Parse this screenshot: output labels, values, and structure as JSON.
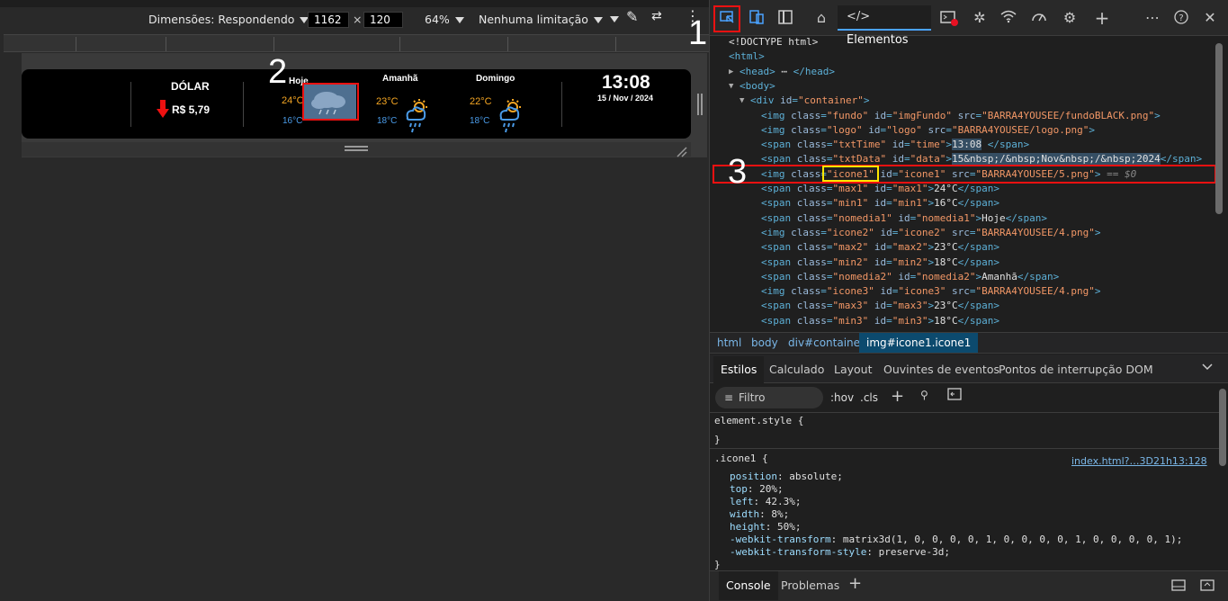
{
  "device_toolbar": {
    "dimensions_label": "Dimensões: Respondendo",
    "width_value": "1162",
    "times": "×",
    "height_value": "120",
    "zoom": "64%",
    "throttle": "Nenhuma limitação"
  },
  "widget": {
    "dollar_title": "DÓLAR",
    "dollar_value": "R$ 5,79",
    "days": [
      {
        "name": "Hoje",
        "max": "24°C",
        "min": "16°C"
      },
      {
        "name": "Amanhã",
        "max": "23°C",
        "min": "18°C"
      },
      {
        "name": "Domingo",
        "max": "22°C",
        "min": "18°C"
      }
    ],
    "time": "13:08",
    "date": "15 / Nov / 2024"
  },
  "annotations": {
    "n1": "1",
    "n2": "2",
    "n3": "3"
  },
  "devtools": {
    "tab_elements": "Elementos",
    "dom_lines": [
      {
        "indent": 0,
        "parts": [
          [
            "txt",
            "<!DOCTYPE html>"
          ]
        ]
      },
      {
        "indent": 0,
        "parts": [
          [
            "tag",
            "<html>"
          ]
        ]
      },
      {
        "indent": 1,
        "arrow": "▶",
        "parts": [
          [
            "tag",
            "<head>"
          ],
          [
            "txt",
            " ⋯ "
          ],
          [
            "tag",
            "</head>"
          ]
        ]
      },
      {
        "indent": 1,
        "arrow": "▼",
        "parts": [
          [
            "tag",
            "<body>"
          ]
        ]
      },
      {
        "indent": 2,
        "arrow": "▼",
        "parts": [
          [
            "tag",
            "<div "
          ],
          [
            "attr",
            "id"
          ],
          [
            "tag",
            "="
          ],
          [
            "val",
            "\"container\""
          ],
          [
            "tag",
            ">"
          ]
        ]
      },
      {
        "indent": 3,
        "parts": [
          [
            "tag",
            "<img "
          ],
          [
            "attr",
            "class"
          ],
          [
            "tag",
            "="
          ],
          [
            "val",
            "\"fundo\""
          ],
          [
            "attr",
            " id"
          ],
          [
            "tag",
            "="
          ],
          [
            "val",
            "\"imgFundo\""
          ],
          [
            "attr",
            " src"
          ],
          [
            "tag",
            "="
          ],
          [
            "val",
            "\"BARRA4YOUSEE/fundoBLACK.png\""
          ],
          [
            "tag",
            ">"
          ]
        ]
      },
      {
        "indent": 3,
        "parts": [
          [
            "tag",
            "<img "
          ],
          [
            "attr",
            "class"
          ],
          [
            "tag",
            "="
          ],
          [
            "val",
            "\"logo\""
          ],
          [
            "attr",
            " id"
          ],
          [
            "tag",
            "="
          ],
          [
            "val",
            "\"logo\""
          ],
          [
            "attr",
            " src"
          ],
          [
            "tag",
            "="
          ],
          [
            "val",
            "\"BARRA4YOUSEE/logo.png\""
          ],
          [
            "tag",
            ">"
          ]
        ]
      },
      {
        "indent": 3,
        "parts": [
          [
            "tag",
            "<span "
          ],
          [
            "attr",
            "class"
          ],
          [
            "tag",
            "="
          ],
          [
            "val",
            "\"txtTime\""
          ],
          [
            "attr",
            " id"
          ],
          [
            "tag",
            "="
          ],
          [
            "val",
            "\"time\""
          ],
          [
            "tag",
            ">"
          ],
          [
            "hl",
            "13:08"
          ],
          [
            "tag",
            " </span>"
          ]
        ]
      },
      {
        "indent": 3,
        "parts": [
          [
            "tag",
            "<span "
          ],
          [
            "attr",
            "class"
          ],
          [
            "tag",
            "="
          ],
          [
            "val",
            "\"txtData\""
          ],
          [
            "attr",
            " id"
          ],
          [
            "tag",
            "="
          ],
          [
            "val",
            "\"data\""
          ],
          [
            "tag",
            ">"
          ],
          [
            "hl",
            "15&nbsp;/&nbsp;Nov&nbsp;/&nbsp;2024"
          ],
          [
            "tag",
            "</span>"
          ]
        ]
      },
      {
        "indent": 3,
        "selected": true,
        "parts": [
          [
            "tag",
            "<img "
          ],
          [
            "attr",
            "class"
          ],
          [
            "tag",
            "="
          ],
          [
            "val",
            "\"icone1\""
          ],
          [
            "attr",
            " id"
          ],
          [
            "tag",
            "="
          ],
          [
            "val",
            "\"icone1\""
          ],
          [
            "attr",
            " src"
          ],
          [
            "tag",
            "="
          ],
          [
            "val",
            "\"BARRA4YOUSEE/5.png\""
          ],
          [
            "tag",
            ">"
          ],
          [
            "dim",
            " == $0"
          ]
        ]
      },
      {
        "indent": 3,
        "parts": [
          [
            "tag",
            "<span "
          ],
          [
            "attr",
            "class"
          ],
          [
            "tag",
            "="
          ],
          [
            "val",
            "\"max1\""
          ],
          [
            "attr",
            " id"
          ],
          [
            "tag",
            "="
          ],
          [
            "val",
            "\"max1\""
          ],
          [
            "tag",
            ">"
          ],
          [
            "txt",
            "24°C"
          ],
          [
            "tag",
            "</span>"
          ]
        ]
      },
      {
        "indent": 3,
        "parts": [
          [
            "tag",
            "<span "
          ],
          [
            "attr",
            "class"
          ],
          [
            "tag",
            "="
          ],
          [
            "val",
            "\"min1\""
          ],
          [
            "attr",
            " id"
          ],
          [
            "tag",
            "="
          ],
          [
            "val",
            "\"min1\""
          ],
          [
            "tag",
            ">"
          ],
          [
            "txt",
            "16°C"
          ],
          [
            "tag",
            "</span>"
          ]
        ]
      },
      {
        "indent": 3,
        "parts": [
          [
            "tag",
            "<span "
          ],
          [
            "attr",
            "class"
          ],
          [
            "tag",
            "="
          ],
          [
            "val",
            "\"nomedia1\""
          ],
          [
            "attr",
            " id"
          ],
          [
            "tag",
            "="
          ],
          [
            "val",
            "\"nomedia1\""
          ],
          [
            "tag",
            ">"
          ],
          [
            "txt",
            "Hoje"
          ],
          [
            "tag",
            "</span>"
          ]
        ]
      },
      {
        "indent": 3,
        "parts": [
          [
            "tag",
            "<img "
          ],
          [
            "attr",
            "class"
          ],
          [
            "tag",
            "="
          ],
          [
            "val",
            "\"icone2\""
          ],
          [
            "attr",
            " id"
          ],
          [
            "tag",
            "="
          ],
          [
            "val",
            "\"icone2\""
          ],
          [
            "attr",
            " src"
          ],
          [
            "tag",
            "="
          ],
          [
            "val",
            "\"BARRA4YOUSEE/4.png\""
          ],
          [
            "tag",
            ">"
          ]
        ]
      },
      {
        "indent": 3,
        "parts": [
          [
            "tag",
            "<span "
          ],
          [
            "attr",
            "class"
          ],
          [
            "tag",
            "="
          ],
          [
            "val",
            "\"max2\""
          ],
          [
            "attr",
            " id"
          ],
          [
            "tag",
            "="
          ],
          [
            "val",
            "\"max2\""
          ],
          [
            "tag",
            ">"
          ],
          [
            "txt",
            "23°C"
          ],
          [
            "tag",
            "</span>"
          ]
        ]
      },
      {
        "indent": 3,
        "parts": [
          [
            "tag",
            "<span "
          ],
          [
            "attr",
            "class"
          ],
          [
            "tag",
            "="
          ],
          [
            "val",
            "\"min2\""
          ],
          [
            "attr",
            " id"
          ],
          [
            "tag",
            "="
          ],
          [
            "val",
            "\"min2\""
          ],
          [
            "tag",
            ">"
          ],
          [
            "txt",
            "18°C"
          ],
          [
            "tag",
            "</span>"
          ]
        ]
      },
      {
        "indent": 3,
        "parts": [
          [
            "tag",
            "<span "
          ],
          [
            "attr",
            "class"
          ],
          [
            "tag",
            "="
          ],
          [
            "val",
            "\"nomedia2\""
          ],
          [
            "attr",
            " id"
          ],
          [
            "tag",
            "="
          ],
          [
            "val",
            "\"nomedia2\""
          ],
          [
            "tag",
            ">"
          ],
          [
            "txt",
            "Amanhã"
          ],
          [
            "tag",
            "</span>"
          ]
        ]
      },
      {
        "indent": 3,
        "parts": [
          [
            "tag",
            "<img "
          ],
          [
            "attr",
            "class"
          ],
          [
            "tag",
            "="
          ],
          [
            "val",
            "\"icone3\""
          ],
          [
            "attr",
            " id"
          ],
          [
            "tag",
            "="
          ],
          [
            "val",
            "\"icone3\""
          ],
          [
            "attr",
            " src"
          ],
          [
            "tag",
            "="
          ],
          [
            "val",
            "\"BARRA4YOUSEE/4.png\""
          ],
          [
            "tag",
            ">"
          ]
        ]
      },
      {
        "indent": 3,
        "parts": [
          [
            "tag",
            "<span "
          ],
          [
            "attr",
            "class"
          ],
          [
            "tag",
            "="
          ],
          [
            "val",
            "\"max3\""
          ],
          [
            "attr",
            " id"
          ],
          [
            "tag",
            "="
          ],
          [
            "val",
            "\"max3\""
          ],
          [
            "tag",
            ">"
          ],
          [
            "txt",
            "23°C"
          ],
          [
            "tag",
            "</span>"
          ]
        ]
      },
      {
        "indent": 3,
        "parts": [
          [
            "tag",
            "<span "
          ],
          [
            "attr",
            "class"
          ],
          [
            "tag",
            "="
          ],
          [
            "val",
            "\"min3\""
          ],
          [
            "attr",
            " id"
          ],
          [
            "tag",
            "="
          ],
          [
            "val",
            "\"min3\""
          ],
          [
            "tag",
            ">"
          ],
          [
            "txt",
            "18°C"
          ],
          [
            "tag",
            "</span>"
          ]
        ]
      }
    ],
    "breadcrumbs": [
      "html",
      "body",
      "div#container"
    ],
    "breadcrumb_active": "img#icone1.icone1",
    "sub_tabs": [
      "Estilos",
      "Calculado",
      "Layout",
      "Ouvintes de eventos",
      "Pontos de interrupção DOM"
    ],
    "filter_placeholder": "Filtro",
    "hov": ":hov",
    "cls": ".cls",
    "element_style": "element.style {",
    "close_brace": "}",
    "rule_selector": ".icone1 {",
    "rule_source": "index.html?…3D21h13:128",
    "rule_props": [
      {
        "name": "position",
        "value": "absolute;"
      },
      {
        "name": "top",
        "value": "20%;"
      },
      {
        "name": "left",
        "value": "42.3%;"
      },
      {
        "name": "width",
        "value": "8%;"
      },
      {
        "name": "height",
        "value": "50%;"
      },
      {
        "name": "-webkit-transform",
        "value": "matrix3d(1, 0, 0, 0, 0, 1, 0, 0, 0, 0, 1, 0, 0, 0, 0, 1);"
      },
      {
        "name": "-webkit-transform-style",
        "value": "preserve-3d;"
      }
    ],
    "drawer_tabs": [
      "Console",
      "Problemas"
    ]
  },
  "colors": {
    "accent": "#4aa3ff",
    "orange": "#f5a623",
    "blue": "#4a9be8",
    "red": "#e11"
  }
}
